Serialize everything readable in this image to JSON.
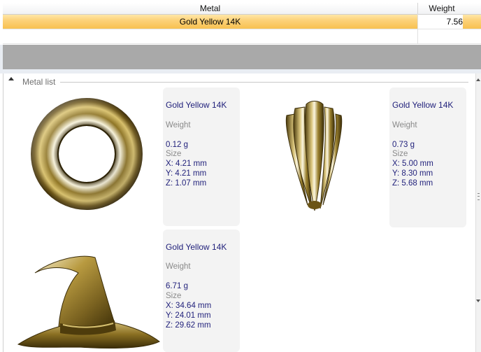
{
  "grid": {
    "columns": {
      "metal": "Metal",
      "weight": "Weight"
    },
    "rows": [
      {
        "metal": "Gold Yellow 14K",
        "weight": "7.56"
      }
    ]
  },
  "metal_list": {
    "title": "Metal list",
    "items": [
      {
        "icon": "ring-torus-icon",
        "metal": "Gold Yellow 14K",
        "weight_label": "Weight",
        "weight": "0.12 g",
        "size_label": "Size",
        "x": "X: 4.21 mm",
        "y": "Y: 4.21 mm",
        "z": "Z: 1.07 mm"
      },
      {
        "icon": "fluted-bail-icon",
        "metal": "Gold Yellow 14K",
        "weight_label": "Weight",
        "weight": "0.73 g",
        "size_label": "Size",
        "x": "X: 5.00 mm",
        "y": "Y: 8.30 mm",
        "z": "Z: 5.68 mm"
      },
      {
        "icon": "witch-hat-icon",
        "metal": "Gold Yellow 14K",
        "weight_label": "Weight",
        "weight": "6.71 g",
        "size_label": "Size",
        "x": "X: 34.64 mm",
        "y": "Y: 24.01 mm",
        "z": "Z: 29.62 mm"
      }
    ]
  },
  "colors": {
    "selected_row": "#f8c150",
    "band": "#a9a9a9",
    "info_text": "#1f1f7a",
    "gold": "#b8962f"
  }
}
